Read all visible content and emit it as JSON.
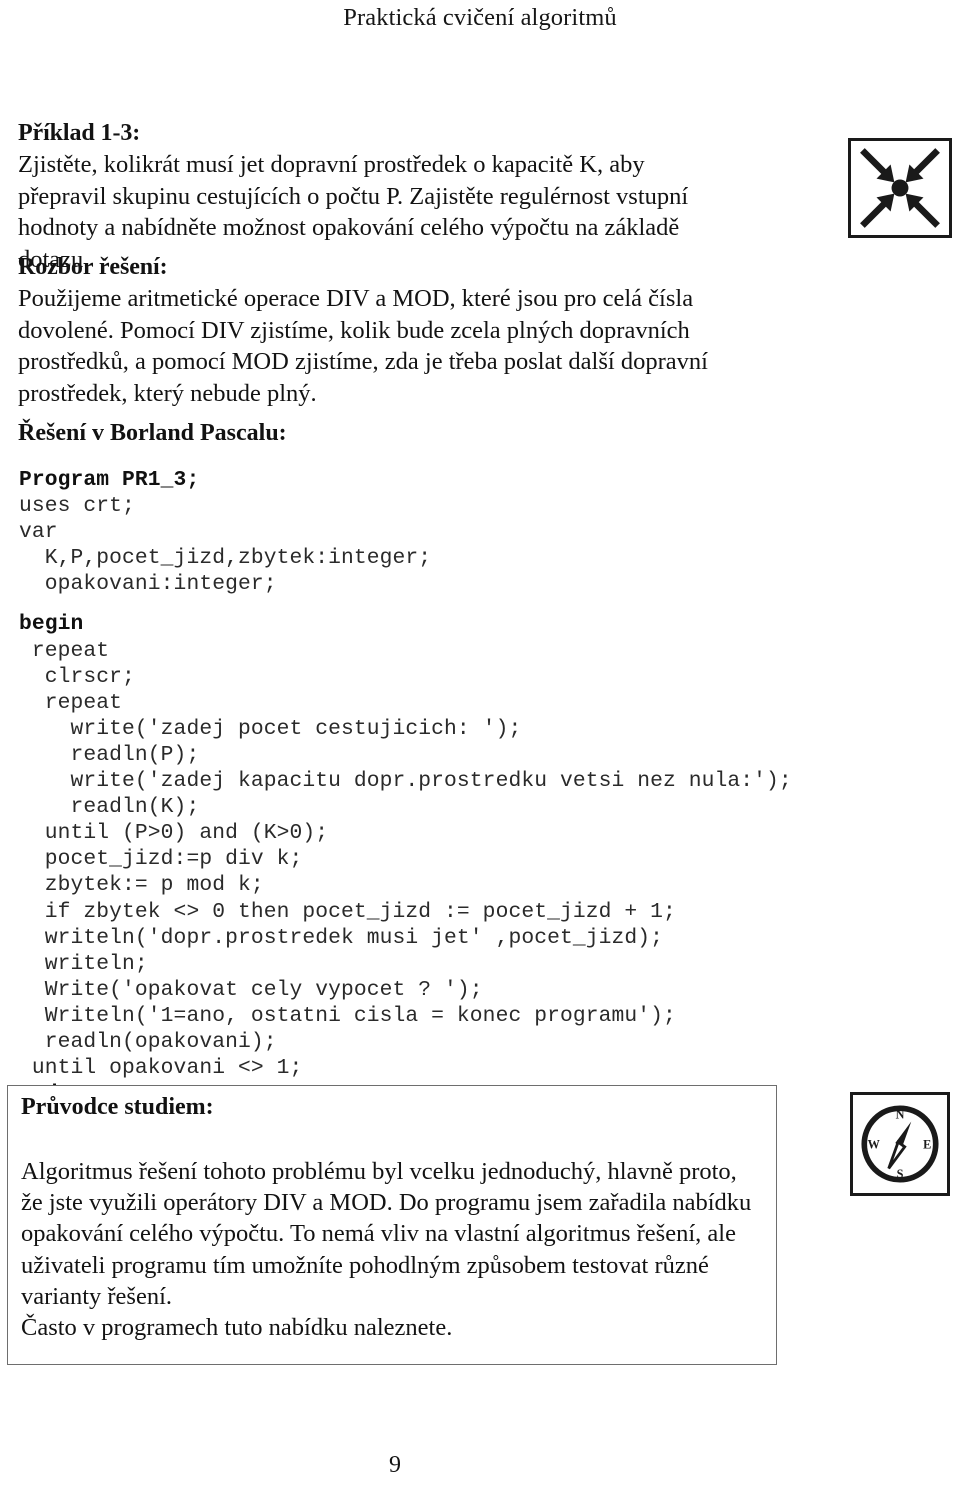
{
  "header": {
    "running_title": "Praktická cvičení algoritmů"
  },
  "example": {
    "title": "Příklad 1-3:",
    "body": "Zjistěte, kolikrát musí jet dopravní prostředek o kapacitě K, aby přepravil skupinu cestujících o počtu P. Zajistěte regulérnost vstupní hodnoty a nabídněte možnost opakování celého výpočtu na základě dotazu."
  },
  "analysis": {
    "title": "Rozbor řešení:",
    "body": "Použijeme aritmetické operace DIV a MOD, které jsou pro celá čísla dovolené. Pomocí DIV zjistíme, kolik bude zcela plných dopravních prostředků, a pomocí MOD zjistíme, zda je třeba poslat další dopravní prostředek, který nebude plný."
  },
  "solution": {
    "heading": "Řešení v Borland Pascalu:",
    "code_lines": [
      {
        "text": "Program PR1_3;",
        "bold": true
      },
      {
        "text": "uses crt;",
        "bold": false
      },
      {
        "text": "var",
        "bold": false
      },
      {
        "text": "  K,P,pocet_jizd,zbytek:integer;",
        "bold": false
      },
      {
        "text": "  opakovani:integer;",
        "bold": false
      },
      {
        "text": "",
        "bold": false
      },
      {
        "text": "begin",
        "bold": true
      },
      {
        "text": " repeat",
        "bold": false
      },
      {
        "text": "  clrscr;",
        "bold": false
      },
      {
        "text": "  repeat",
        "bold": false
      },
      {
        "text": "    write('zadej pocet cestujicich: ');",
        "bold": false
      },
      {
        "text": "    readln(P);",
        "bold": false
      },
      {
        "text": "    write('zadej kapacitu dopr.prostredku vetsi nez nula:');",
        "bold": false
      },
      {
        "text": "    readln(K);",
        "bold": false
      },
      {
        "text": "  until (P>0) and (K>0);",
        "bold": false
      },
      {
        "text": "  pocet_jizd:=p div k;",
        "bold": false
      },
      {
        "text": "  zbytek:= p mod k;",
        "bold": false
      },
      {
        "text": "  if zbytek <> 0 then pocet_jizd := pocet_jizd + 1;",
        "bold": false
      },
      {
        "text": "  writeln('dopr.prostredek musi jet' ,pocet_jizd);",
        "bold": false
      },
      {
        "text": "  writeln;",
        "bold": false
      },
      {
        "text": "  Write('opakovat cely vypocet ? ');",
        "bold": false
      },
      {
        "text": "  Writeln('1=ano, ostatni cisla = konec programu');",
        "bold": false
      },
      {
        "text": "  readln(opakovani);",
        "bold": false
      },
      {
        "text": " until opakovani <> 1;",
        "bold": false
      },
      {
        "text": "end.",
        "bold": true
      }
    ]
  },
  "guide": {
    "title": "Průvodce studiem:",
    "paragraphs": [
      "Algoritmus řešení tohoto problému byl vcelku jednoduchý, hlavně proto, že jste využili operátory DIV a MOD. Do programu jsem zařadila nabídku opakování celého výpočtu. To nemá vliv na vlastní algoritmus řešení, ale uživateli programu tím umožníte pohodlným způsobem testovat různé varianty řešení.",
      "Často v programech tuto nabídku naleznete."
    ]
  },
  "icons": {
    "converging_arrows": "converging-arrows-icon",
    "compass": "compass-icon",
    "compass_labels": {
      "north": "N",
      "west": "W",
      "east": "E",
      "south": "S"
    }
  },
  "footer": {
    "page_number": "9"
  },
  "colors": {
    "text": "#131313",
    "box_border": "#6e6e6e",
    "icon_ink": "#1a1a1a",
    "background": "#ffffff"
  }
}
